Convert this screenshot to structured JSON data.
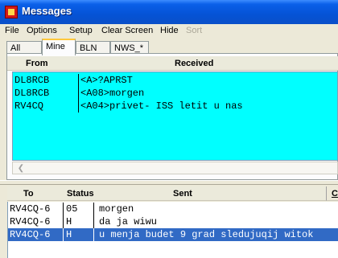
{
  "window": {
    "title": "Messages",
    "app_icon": "app-icon"
  },
  "menu": [
    {
      "label": "File",
      "enabled": true
    },
    {
      "label": "Options",
      "enabled": true
    },
    {
      "label": "Setup",
      "enabled": true
    },
    {
      "label": "Clear Screen",
      "enabled": true
    },
    {
      "label": "Hide",
      "enabled": true
    },
    {
      "label": "Sort",
      "enabled": false
    }
  ],
  "tabs": [
    {
      "label": "All",
      "active": false
    },
    {
      "label": "Mine",
      "active": true
    },
    {
      "label": "BLN",
      "active": false
    },
    {
      "label": "NWS_*",
      "active": false
    }
  ],
  "received": {
    "columns": {
      "from": "From",
      "received": "Received"
    },
    "rows": [
      {
        "from": "DL8RCB",
        "text": "<A>?APRST"
      },
      {
        "from": "DL8RCB",
        "text": "<A08>morgen"
      },
      {
        "from": "RV4CQ",
        "text": "<A04>privet-  ISS letit u nas"
      }
    ],
    "scroll_left_icon": "scroll-left-arrow-icon"
  },
  "sent": {
    "columns": {
      "to": "To",
      "status": "Status",
      "sent": "Sent"
    },
    "clear_label": "C",
    "rows": [
      {
        "to": "RV4CQ-6",
        "status": "05",
        "text": "morgen",
        "selected": false
      },
      {
        "to": "RV4CQ-6",
        "status": "H",
        "text": "da ja wiwu",
        "selected": false
      },
      {
        "to": "RV4CQ-6",
        "status": "H",
        "text": "u menja budet 9 grad sledujuqij witok",
        "selected": true
      }
    ]
  },
  "colors": {
    "titlebar": "#0553d6",
    "received_bg": "#00ffff",
    "selection": "#316ac5",
    "tab_active_border": "#ffc83c"
  }
}
